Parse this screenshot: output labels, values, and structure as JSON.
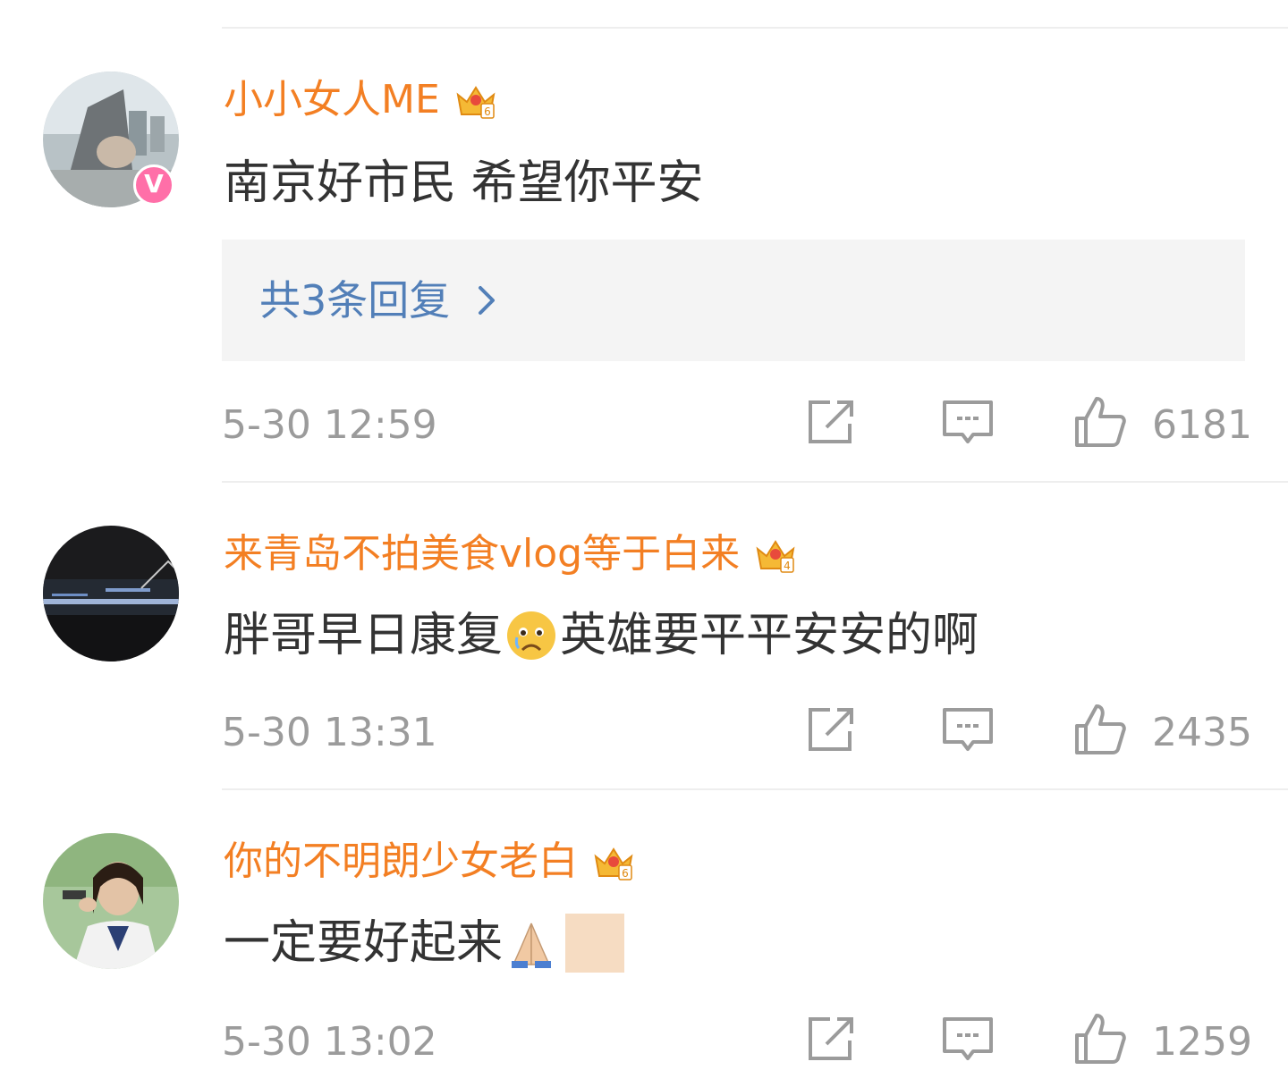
{
  "comments": [
    {
      "username": "小小女人ME",
      "crown_level": "6",
      "verified_badge": "V",
      "text": "南京好市民 希望你平安",
      "replies_label": "共3条回复",
      "time": "5-30 12:59",
      "likes": "6181"
    },
    {
      "username": "来青岛不拍美食vlog等于白来",
      "crown_level": "4",
      "text_before": "胖哥早日康复",
      "text_after": "英雄要平平安安的啊",
      "emoji": "crying-face-emoji",
      "time": "5-30 13:31",
      "likes": "2435"
    },
    {
      "username": "你的不明朗少女老白",
      "crown_level": "6",
      "text": "一定要好起来",
      "emoji": "folded-hands-emoji",
      "time": "5-30 13:02",
      "likes": "1259"
    }
  ],
  "colors": {
    "username": "#f37f23",
    "reply_link": "#527fb8",
    "meta": "#9b9b9b",
    "text": "#333333",
    "reply_bg": "#f4f4f4"
  }
}
